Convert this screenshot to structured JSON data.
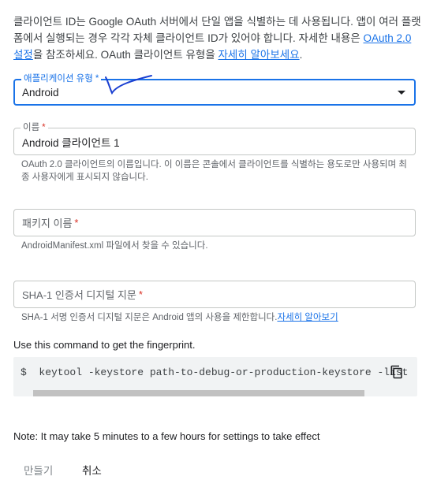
{
  "intro": {
    "text_before": "클라이언트 ID는 Google OAuth 서버에서 단일 앱을 식별하는 데 사용됩니다. 앱이 여러 플랫폼에서 실행되는 경우 각각 자체 클라이언트 ID가 있어야 합니다. 자세한 내용은 ",
    "oauth_link": "OAuth 2.0 설정",
    "text_middle": "을 참조하세요. OAuth 클라이언트 유형을 ",
    "learn_more_link": "자세히 알아보세요",
    "text_after": "."
  },
  "app_type": {
    "label": "애플리케이션 유형",
    "required_mark": "*",
    "value": "Android"
  },
  "name": {
    "label": "이름",
    "required_mark": "*",
    "value": "Android 클라이언트 1",
    "hint": "OAuth 2.0 클라이언트의 이름입니다. 이 이름은 콘솔에서 클라이언트를 식별하는 용도로만 사용되며 최종 사용자에게 표시되지 않습니다."
  },
  "package": {
    "placeholder": "패키지 이름",
    "required_mark": "*",
    "hint": "AndroidManifest.xml 파일에서 찾을 수 있습니다."
  },
  "sha1": {
    "placeholder": "SHA-1 인증서 디지털 지문",
    "required_mark": "*",
    "hint": "SHA-1 서명 인증서 디지털 지문은 Android 앱의 사용을 제한합니다.",
    "hint_link": "자세히 알아보기"
  },
  "command": {
    "label": "Use this command to get the fingerprint.",
    "code": "$  keytool -keystore path-to-debug-or-production-keystore -list"
  },
  "note": "Note: It may take 5 minutes to a few hours for settings to take effect",
  "buttons": {
    "create": "만들기",
    "cancel": "취소"
  },
  "icons": {
    "copy": "copy-icon",
    "dropdown": "dropdown-arrow-icon"
  },
  "colors": {
    "accent": "#1a73e8",
    "required": "#d93025",
    "annotation": "#1a3fd1"
  }
}
